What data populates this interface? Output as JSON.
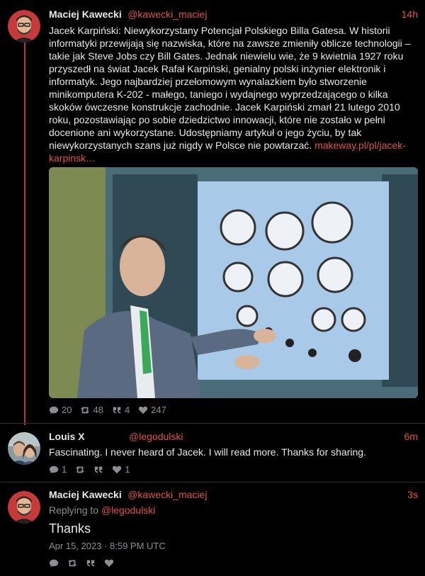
{
  "posts": [
    {
      "author": "Maciej Kawecki",
      "handle": "@kawecki_maciej",
      "time": "14h",
      "text": "Jacek Karpiński: Niewykorzystany Potencjał Polskiego Billa Gatesa. W historii informatyki przewijają się nazwiska, które na zawsze zmieniły oblicze technologii – takie jak Steve Jobs czy Bill Gates. Jednak niewielu wie, że 9 kwietnia 1927 roku przyszedł na świat Jacek Rafał Karpiński, genialny polski inżynier elektronik i informatyk. Jego najbardziej przełomowym wynalazkiem było stworzenie minikomputera K-202 - małego, taniego i wydajnego wyprzedzającego o kilka skoków ówczesne konstrukcje zachodnie. Jacek Karpiński zmarł 21 lutego 2010 roku, pozostawiając po sobie dziedzictwo innowacji, które nie zostało w pełni docenione ani wykorzystane. Udostępniamy artykuł o jego życiu, by tak niewykorzystanych szans już nigdy w Polsce nie powtarzać.",
      "link": "makeway.pl/pl/jacek-karpinsk…",
      "replies": "20",
      "reposts": "48",
      "quotes": "4",
      "likes": "247"
    },
    {
      "author": "Louis X",
      "handle": "@legodulski",
      "time": "6m",
      "text": "Fascinating. I never heard of Jacek. I will read more. Thanks for sharing.",
      "replies": "1",
      "reposts": "",
      "quotes": "",
      "likes": "1"
    },
    {
      "author": "Maciej Kawecki",
      "handle": "@kawecki_maciej",
      "time": "3s",
      "replying_prefix": "Replying to",
      "replying_to": "@legodulski",
      "text": "Thanks",
      "date": "Apr 15, 2023 · 8:59 PM UTC"
    }
  ],
  "icons": {
    "reply": "reply-icon",
    "repost": "repost-icon",
    "quote": "quote-icon",
    "like": "heart-icon"
  },
  "colors": {
    "accent": "#e0524a",
    "background": "#000000",
    "text": "#e7e9ea",
    "muted": "#8b8f94",
    "thread_line": "#b03a3a"
  }
}
